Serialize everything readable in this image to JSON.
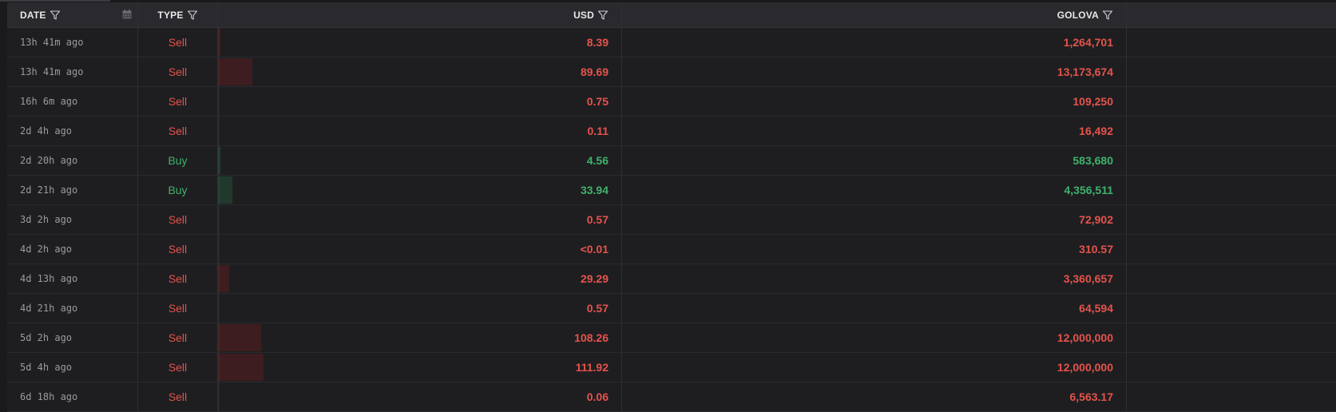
{
  "columns": {
    "date": "DATE",
    "type": "TYPE",
    "usd": "USD",
    "golova": "GOLOVA"
  },
  "icons": {
    "filter": "filter-icon",
    "calendar": "calendar-icon"
  },
  "colors": {
    "sell": "#e5534b",
    "buy": "#3fb26b"
  },
  "rows": [
    {
      "date": "13h 41m ago",
      "type": "Sell",
      "usd": "8.39",
      "golova": "1,264,701",
      "side": "sell",
      "volume_fraction": 0.005
    },
    {
      "date": "13h 41m ago",
      "type": "Sell",
      "usd": "89.69",
      "golova": "13,173,674",
      "side": "sell",
      "volume_fraction": 0.085
    },
    {
      "date": "16h 6m ago",
      "type": "Sell",
      "usd": "0.75",
      "golova": "109,250",
      "side": "sell",
      "volume_fraction": 0.0
    },
    {
      "date": "2d 4h ago",
      "type": "Sell",
      "usd": "0.11",
      "golova": "16,492",
      "side": "sell",
      "volume_fraction": 0.0
    },
    {
      "date": "2d 20h ago",
      "type": "Buy",
      "usd": "4.56",
      "golova": "583,680",
      "side": "buy",
      "volume_fraction": 0.005
    },
    {
      "date": "2d 21h ago",
      "type": "Buy",
      "usd": "33.94",
      "golova": "4,356,511",
      "side": "buy",
      "volume_fraction": 0.035
    },
    {
      "date": "3d 2h ago",
      "type": "Sell",
      "usd": "0.57",
      "golova": "72,902",
      "side": "sell",
      "volume_fraction": 0.0
    },
    {
      "date": "4d 2h ago",
      "type": "Sell",
      "usd": "<0.01",
      "golova": "310.57",
      "side": "sell",
      "volume_fraction": 0.0
    },
    {
      "date": "4d 13h ago",
      "type": "Sell",
      "usd": "29.29",
      "golova": "3,360,657",
      "side": "sell",
      "volume_fraction": 0.027
    },
    {
      "date": "4d 21h ago",
      "type": "Sell",
      "usd": "0.57",
      "golova": "64,594",
      "side": "sell",
      "volume_fraction": 0.0
    },
    {
      "date": "5d 2h ago",
      "type": "Sell",
      "usd": "108.26",
      "golova": "12,000,000",
      "side": "sell",
      "volume_fraction": 0.107
    },
    {
      "date": "5d 4h ago",
      "type": "Sell",
      "usd": "111.92",
      "golova": "12,000,000",
      "side": "sell",
      "volume_fraction": 0.113
    },
    {
      "date": "6d 18h ago",
      "type": "Sell",
      "usd": "0.06",
      "golova": "6,563.17",
      "side": "sell",
      "volume_fraction": 0.0
    }
  ]
}
